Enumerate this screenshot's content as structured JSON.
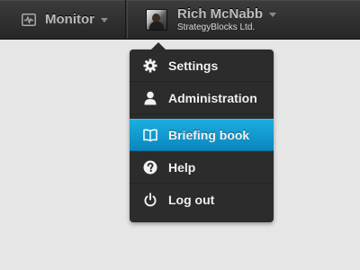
{
  "topbar": {
    "monitor": {
      "label": "Monitor",
      "icon": "pulse-monitor-icon"
    },
    "user": {
      "name": "Rich McNabb",
      "company": "StrategyBlocks Ltd."
    }
  },
  "menu": {
    "items": [
      {
        "label": "Settings",
        "icon": "gear-icon",
        "active": false
      },
      {
        "label": "Administration",
        "icon": "person-icon",
        "active": false
      },
      {
        "label": "Briefing book",
        "icon": "book-icon",
        "active": true
      },
      {
        "label": "Help",
        "icon": "question-icon",
        "active": false
      },
      {
        "label": "Log out",
        "icon": "power-icon",
        "active": false
      }
    ]
  },
  "colors": {
    "background": "#e6e6e6",
    "topbar": "#303030",
    "menu": "#2c2c2c",
    "active": "#1296cc",
    "menu_text": "#f2f2f2",
    "nav_text": "#b9b9b9"
  }
}
